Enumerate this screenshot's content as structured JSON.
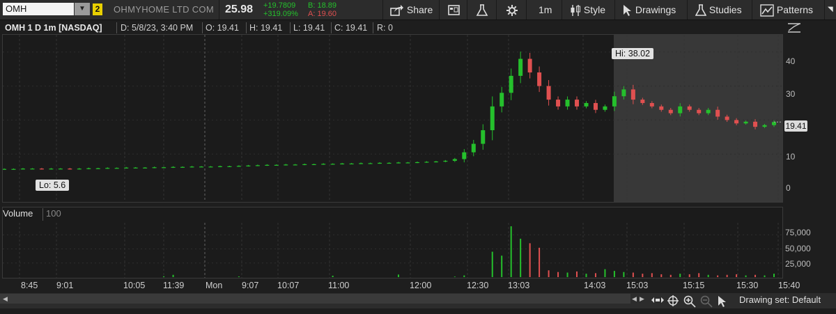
{
  "toolbar": {
    "symbol": "OMH",
    "link_number": "2",
    "company": "OHMYHOME LTD COM",
    "last_price": "25.98",
    "net_change": "+19.7809",
    "pct_change": "+319.09%",
    "bid": "B: 18.89",
    "ask": "A: 19.60",
    "share_label": "Share",
    "interval_label": "1m",
    "style_label": "Style",
    "drawings_label": "Drawings",
    "studies_label": "Studies",
    "patterns_label": "Patterns",
    "colors": {
      "up": "#25c02c",
      "down": "#e05050",
      "link": "#e9d000"
    }
  },
  "header": {
    "title": "OMH 1 D 1m [NASDAQ]",
    "date": "D: 5/8/23, 3:40 PM",
    "open": "O: 19.41",
    "high": "H: 19.41",
    "low": "L: 19.41",
    "close": "C: 19.41",
    "range": "R: 0"
  },
  "price_panel": {
    "hi_label": "Hi: 38.02",
    "lo_label": "Lo: 5.6",
    "last_badge": "19.41",
    "y_ticks": [
      "40",
      "30",
      "20",
      "10",
      "0"
    ]
  },
  "volume_panel": {
    "label": "Volume",
    "length": "100",
    "y_ticks": [
      "75,000",
      "50,000",
      "25,000"
    ]
  },
  "x_ticks": [
    "8:45",
    "9:01",
    "10:05",
    "11:39",
    "Mon",
    "9:07",
    "10:07",
    "11:00",
    "12:00",
    "12:30",
    "13:03",
    "14:03",
    "15:03",
    "15:15",
    "15:30",
    "15:40"
  ],
  "footer": {
    "drawing_set": "Drawing set: Default"
  },
  "chart_data": {
    "type": "candlestick",
    "symbol": "OMH",
    "price_ylim": [
      0,
      42
    ],
    "volume_ylim": [
      0,
      95000
    ],
    "price_series": [
      5.6,
      5.6,
      5.7,
      5.7,
      5.6,
      5.7,
      5.7,
      5.6,
      5.7,
      5.8,
      5.8,
      5.9,
      5.9,
      6.0,
      6.0,
      6.0,
      6.1,
      6.1,
      6.2,
      6.2,
      6.3,
      6.3,
      6.3,
      6.4,
      6.4,
      6.5,
      6.6,
      6.7,
      6.8,
      6.8,
      6.9,
      6.9,
      7.0,
      7.0,
      7.1,
      7.1,
      7.2,
      7.2,
      7.3,
      7.3,
      7.4,
      7.4,
      7.5,
      7.5,
      7.6,
      7.7,
      7.8,
      8.0,
      8.5,
      10.5,
      13,
      17,
      24,
      28,
      33,
      38,
      34,
      30,
      26,
      24,
      26,
      24,
      25,
      23,
      24,
      27,
      29,
      26,
      25,
      24,
      23,
      22,
      24,
      23,
      22,
      23,
      21,
      20,
      19,
      19.5,
      18,
      18.5,
      19.41
    ],
    "volume_series": [
      0,
      0,
      0,
      0,
      0,
      0,
      0,
      0,
      0,
      0,
      0,
      0,
      0,
      0,
      0,
      0,
      0,
      1500,
      4000,
      0,
      0,
      0,
      0,
      0,
      0,
      1200,
      0,
      0,
      0,
      0,
      0,
      0,
      0,
      0,
      0,
      2500,
      0,
      0,
      0,
      0,
      0,
      0,
      4500,
      0,
      0,
      0,
      0,
      0,
      1000,
      3000,
      0,
      0,
      45000,
      38000,
      90000,
      68000,
      60000,
      52000,
      12000,
      9000,
      8000,
      10000,
      6000,
      7000,
      14000,
      11000,
      9000,
      8000,
      6000,
      7000,
      5000,
      4000,
      6000,
      5000,
      7000,
      4000,
      3000,
      4000,
      5000,
      3000,
      4000,
      3000,
      6000
    ]
  }
}
